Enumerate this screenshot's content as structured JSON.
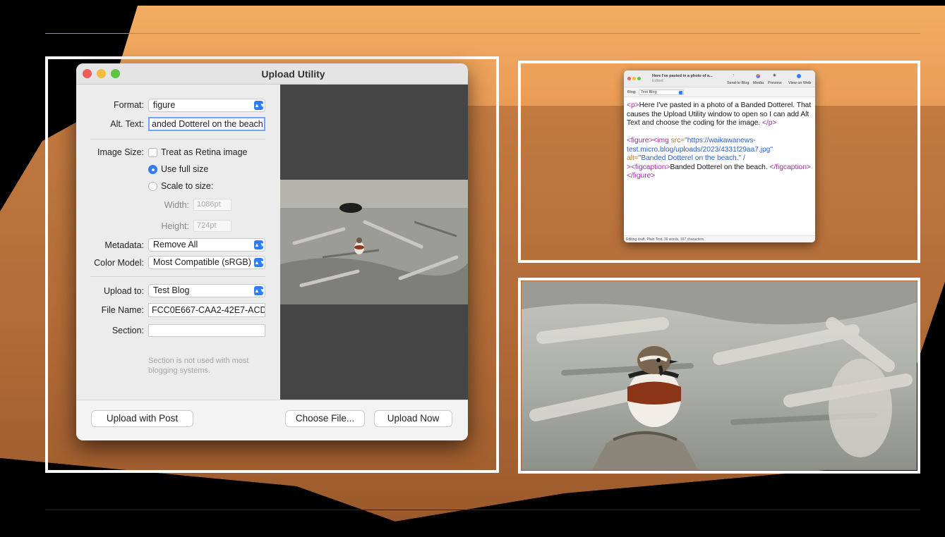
{
  "colors": {
    "sky": "#f1a95f",
    "ground": "#b8733c",
    "frame": "#ffffff",
    "accent": "#2f7cf6"
  },
  "upload_window": {
    "title": "Upload Utility",
    "format": {
      "label": "Format:",
      "value": "figure"
    },
    "alt_text": {
      "label": "Alt. Text:",
      "value": "anded Dotterel on the beach"
    },
    "image_size": {
      "label": "Image Size:",
      "retina_label": "Treat as Retina image",
      "full_size_label": "Use full size",
      "scale_label": "Scale to size:",
      "width_label": "Width:",
      "width_value": "1086pt",
      "height_label": "Height:",
      "height_value": "724pt"
    },
    "metadata": {
      "label": "Metadata:",
      "value": "Remove All"
    },
    "color_model": {
      "label": "Color Model:",
      "value": "Most Compatible (sRGB)"
    },
    "upload_to": {
      "label": "Upload to:",
      "value": "Test Blog"
    },
    "file_name": {
      "label": "File Name:",
      "value": "FCC0E667-CAA2-42E7-ACD"
    },
    "section": {
      "label": "Section:",
      "value": "",
      "hint": "Section is not used with most blogging systems."
    },
    "buttons": {
      "upload_with_post": "Upload with Post",
      "choose_file": "Choose File...",
      "upload_now": "Upload Now"
    }
  },
  "editor_window": {
    "title": "Here I've pasted in a photo of a...",
    "subtitle": "Edited",
    "toolbar": {
      "send": "Send to Blog",
      "media": "Media",
      "preview": "Preview",
      "view": "View on Web"
    },
    "blog_label": "Blog:",
    "blog_value": "Test Blog",
    "p_open": "<p>",
    "p_text": "Here I've pasted in a photo of a Banded Dotterel. That causes the Upload Utility window to open so I can add Alt Text and choose the coding for the image.",
    "p_close": "</p>",
    "fig_open": "<figure><img",
    "src_attr": " src=",
    "src_val": "\"https://waikawanews-test.micro.blog/uploads/2023/4331f29aa7.jpg\"",
    "alt_attr": "alt=",
    "alt_val": "\"Banded Dotterel on the beach.\" /",
    "figcap_open": "><figcaption>",
    "figcap_text": "Banded Dotterel on the beach. ",
    "figcap_close": "</figcaption></figure>",
    "status": "Editing draft, Plain Text, 36 words, 167 characters."
  }
}
